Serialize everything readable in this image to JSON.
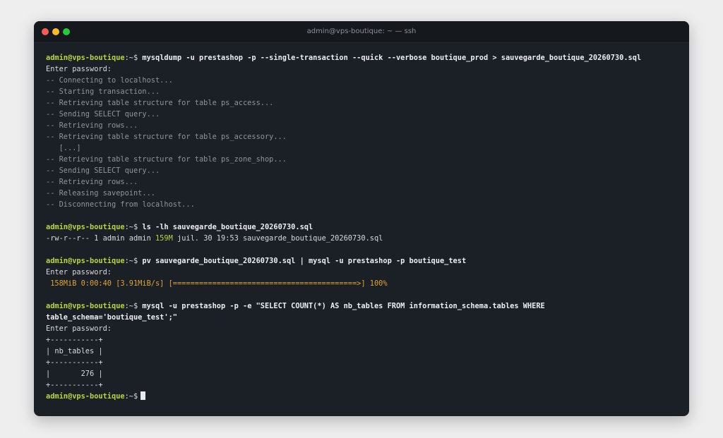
{
  "window": {
    "title": "admin@vps-boutique: ~ — ssh"
  },
  "prompt": {
    "user_host": "admin@vps-boutique",
    "path_suffix": ":~$"
  },
  "commands": {
    "dump": "mysqldump -u prestashop -p --single-transaction --quick --verbose boutique_prod > sauvegarde_boutique_20260730.sql",
    "ls": "ls -lh sauvegarde_boutique_20260730.sql",
    "pv": "pv sauvegarde_boutique_20260730.sql | mysql -u prestashop -p boutique_test",
    "count_line1": "mysql -u prestashop -p -e \"SELECT COUNT(*) AS nb_tables FROM information_schema.tables WHERE",
    "count_line2": "table_schema='boutique_test';\""
  },
  "output": {
    "enter_password": "Enter password:",
    "dump_log": [
      "-- Connecting to localhost...",
      "-- Starting transaction...",
      "-- Retrieving table structure for table ps_access...",
      "-- Sending SELECT query...",
      "-- Retrieving rows...",
      "-- Retrieving table structure for table ps_accessory...",
      "   [...]",
      "-- Retrieving table structure for table ps_zone_shop...",
      "-- Sending SELECT query...",
      "-- Retrieving rows...",
      "-- Releasing savepoint...",
      "-- Disconnecting from localhost..."
    ],
    "ls_result": {
      "prefix": "-rw-r--r-- 1 admin admin ",
      "size": "159M",
      "suffix": " juil. 30 19:53 sauvegarde_boutique_20260730.sql"
    },
    "pv_progress": " 158MiB 0:00:40 [3.91MiB/s] [==========================================>] 100%",
    "table": {
      "border": "+-----------+",
      "header_left": "| ",
      "header": "nb_tables",
      "header_right": " |",
      "row_left": "|       ",
      "value": "276",
      "row_right": " |"
    }
  },
  "colors": {
    "prompt": "#b5d545",
    "progress": "#e0a33a",
    "comment": "#8f949c"
  }
}
